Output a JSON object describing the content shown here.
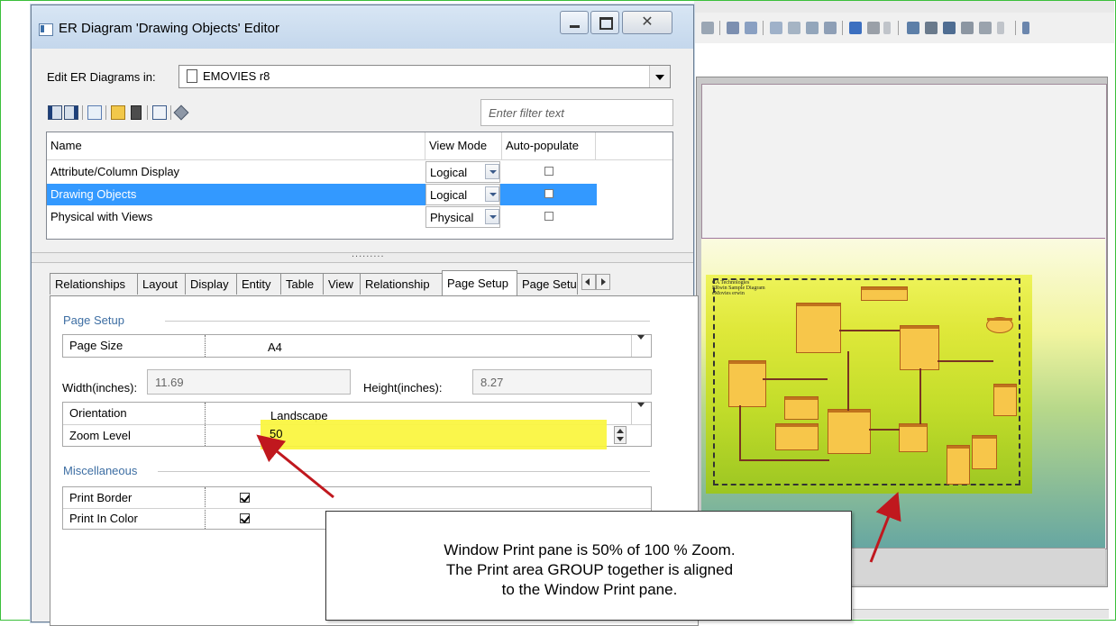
{
  "window": {
    "title": "ER Diagram 'Drawing Objects' Editor",
    "close_glyph": "✕"
  },
  "edit_in": {
    "label": "Edit ER Diagrams in:",
    "value": "EMOVIES r8"
  },
  "filter": {
    "placeholder": "Enter filter text"
  },
  "toolbar_icons": [
    "first-icon",
    "last-icon",
    "sort-icon",
    "new-icon",
    "delete-icon",
    "copy-icon",
    "properties-icon"
  ],
  "grid": {
    "columns": [
      "Name",
      "View Mode",
      "Auto-populate"
    ],
    "rows": [
      {
        "name": "Attribute/Column Display",
        "view_mode": "Logical",
        "auto_populate": false,
        "selected": false
      },
      {
        "name": "Drawing Objects",
        "view_mode": "Logical",
        "auto_populate": false,
        "selected": true
      },
      {
        "name": "Physical with Views",
        "view_mode": "Physical",
        "auto_populate": false,
        "selected": false
      }
    ]
  },
  "splitter": {
    "grip": "........."
  },
  "tabs": [
    {
      "label": "Relationships",
      "active": false
    },
    {
      "label": "Layout",
      "active": false
    },
    {
      "label": "Display",
      "active": false
    },
    {
      "label": "Entity",
      "active": false
    },
    {
      "label": "Table",
      "active": false
    },
    {
      "label": "View",
      "active": false
    },
    {
      "label": "Relationship",
      "active": false
    },
    {
      "label": "Page Setup",
      "active": true
    },
    {
      "label": "Page Setu",
      "active": false
    }
  ],
  "page_setup": {
    "section": "Page Setup",
    "page_size_label": "Page Size",
    "page_size_value": "A4",
    "width_label": "Width(inches):",
    "width_value": "11.69",
    "height_label": "Height(inches):",
    "height_value": "8.27",
    "orientation_label": "Orientation",
    "orientation_value": "Landscape",
    "zoom_label": "Zoom Level",
    "zoom_value": "50"
  },
  "misc": {
    "section": "Miscellaneous",
    "print_border_label": "Print Border",
    "print_border_checked": true,
    "print_color_label": "Print In Color",
    "print_color_checked": true
  },
  "callout": {
    "line1": "Window Print pane is 50% of 100 % Zoom.",
    "line2": "The Print area GROUP together is aligned",
    "line3": "to the Window Print pane."
  },
  "canvas": {
    "mini_title_1": "CA Technologies",
    "mini_title_2": "ERwin Sample Diagram",
    "mini_title_3": "eMovies erwin"
  },
  "colors": {
    "highlight": "#faf53c",
    "selection": "#3399ff",
    "section_label": "#3d6ea3",
    "arrow": "#c0181e",
    "frame": "#3bbf3b"
  }
}
